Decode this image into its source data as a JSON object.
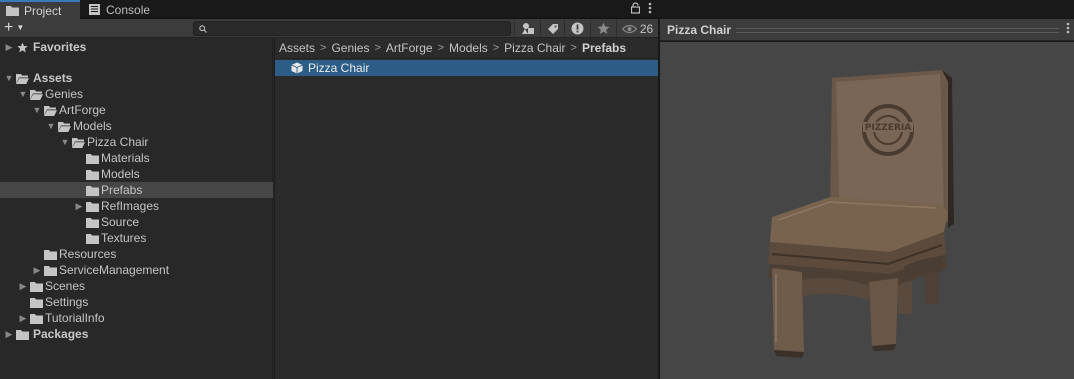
{
  "tabs": [
    {
      "label": "Project",
      "icon": "folder-icon",
      "active": true
    },
    {
      "label": "Console",
      "icon": "console-icon",
      "active": false
    }
  ],
  "toolbar": {
    "create_label": "+",
    "search_placeholder": "",
    "hidden_packages_count": "26"
  },
  "tree": {
    "favorites": "Favorites",
    "assets": "Assets",
    "items": [
      {
        "label": "Genies",
        "depth": 1,
        "expanded": true
      },
      {
        "label": "ArtForge",
        "depth": 2,
        "expanded": true
      },
      {
        "label": "Models",
        "depth": 3,
        "expanded": true
      },
      {
        "label": "Pizza Chair",
        "depth": 4,
        "expanded": true
      },
      {
        "label": "Materials",
        "depth": 5
      },
      {
        "label": "Models",
        "depth": 5
      },
      {
        "label": "Prefabs",
        "depth": 5,
        "selected": true
      },
      {
        "label": "RefImages",
        "depth": 5,
        "collapsed": true
      },
      {
        "label": "Source",
        "depth": 5
      },
      {
        "label": "Textures",
        "depth": 5
      },
      {
        "label": "Resources",
        "depth": 2
      },
      {
        "label": "ServiceManagement",
        "depth": 2,
        "collapsed": true
      },
      {
        "label": "Scenes",
        "depth": 1,
        "collapsed": true
      },
      {
        "label": "Settings",
        "depth": 1
      },
      {
        "label": "TutorialInfo",
        "depth": 1,
        "collapsed": true
      }
    ],
    "packages": "Packages"
  },
  "breadcrumb": [
    "Assets",
    "Genies",
    "ArtForge",
    "Models",
    "Pizza Chair",
    "Prefabs"
  ],
  "assets_list": [
    {
      "label": "Pizza Chair",
      "icon": "prefab-cube-icon",
      "selected": true
    }
  ],
  "preview": {
    "title": "Pizza Chair",
    "box_logo_text": "PIZZERIA"
  },
  "colors": {
    "accent_tab": "#3a79bb",
    "selection": "#2c5d87",
    "panel": "#282828",
    "viewport": "#464646"
  }
}
